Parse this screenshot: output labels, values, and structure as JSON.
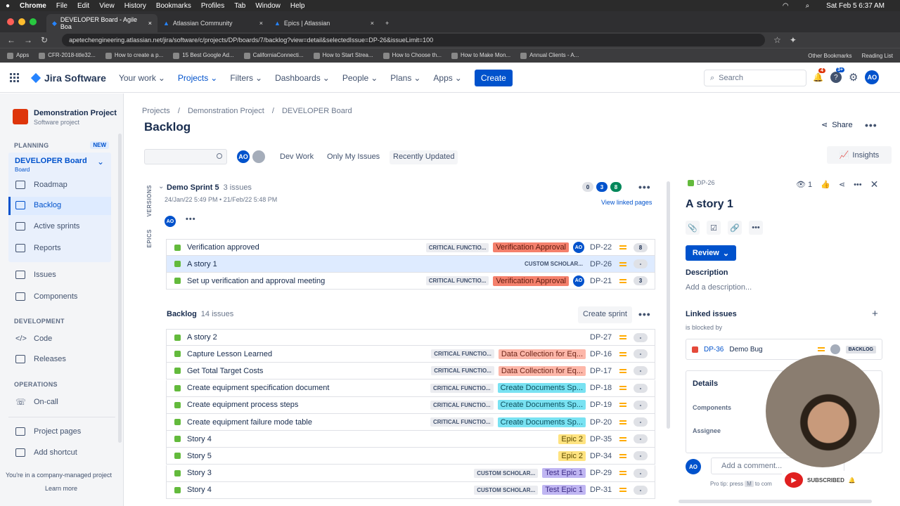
{
  "mac": {
    "app": "Chrome",
    "menus": [
      "File",
      "Edit",
      "View",
      "History",
      "Bookmarks",
      "Profiles",
      "Tab",
      "Window",
      "Help"
    ],
    "datetime": "Sat Feb 5  6:37 AM"
  },
  "browser": {
    "tabs": [
      {
        "label": "DEVELOPER Board - Agile Boa"
      },
      {
        "label": "Atlassian Community"
      },
      {
        "label": "Epics | Atlassian"
      }
    ],
    "url": "apetechengineering.atlassian.net/jira/software/c/projects/DP/boards/7/backlog?view=detail&selectedIssue=DP-26&issueLimit=100",
    "bookmarks": [
      "Apps",
      "CFR-2018-title32...",
      "How to create a p...",
      "15 Best Google Ad...",
      "CaliforniaConnecti...",
      "How to Start Strea...",
      "How to Choose th...",
      "How to Make Mon...",
      "Annual Clients - A..."
    ],
    "bookmarks_right": [
      "Other Bookmarks",
      "Reading List"
    ]
  },
  "jira_nav": {
    "logo": "Jira Software",
    "items": [
      "Your work",
      "Projects",
      "Filters",
      "Dashboards",
      "People",
      "Plans",
      "Apps"
    ],
    "create": "Create",
    "search_placeholder": "Search",
    "notif_badge": "4",
    "help_badge": "3+",
    "avatar": "AO"
  },
  "sidebar": {
    "project_name": "Demonstration Project",
    "project_type": "Software project",
    "planning_label": "PLANNING",
    "new_badge": "NEW",
    "board_title": "DEVELOPER Board",
    "board_sub": "Board",
    "planning_items": [
      "Roadmap",
      "Backlog",
      "Active sprints",
      "Reports"
    ],
    "other_items": [
      "Issues",
      "Components"
    ],
    "dev_label": "DEVELOPMENT",
    "dev_items": [
      "Code",
      "Releases"
    ],
    "ops_label": "OPERATIONS",
    "ops_items": [
      "On-call"
    ],
    "foot_items": [
      "Project pages",
      "Add shortcut"
    ],
    "footer_text": "You're in a company-managed project",
    "learn_more": "Learn more"
  },
  "main": {
    "breadcrumb": [
      "Projects",
      "/",
      "Demonstration Project",
      "/",
      "DEVELOPER Board"
    ],
    "title": "Backlog",
    "share": "Share",
    "insights": "Insights",
    "filters": [
      "Dev Work",
      "Only My Issues",
      "Recently Updated"
    ],
    "filter_avatar": "AO",
    "versions_tab": "VERSIONS",
    "epics_tab": "EPICS",
    "sprint": {
      "name": "Demo Sprint 5",
      "count": "3 issues",
      "dates": "24/Jan/22 5:49 PM  •  21/Feb/22 5:48 PM",
      "counts": [
        "0",
        "3",
        "8"
      ],
      "view_linked": "View linked pages",
      "avatar": "AO",
      "issues": [
        {
          "summary": "Verification approved",
          "label": "CRITICAL FUNCTIO...",
          "epic": "Verification Approval",
          "epic_color": "red",
          "assignee": "AO",
          "key": "DP-22",
          "est": "8"
        },
        {
          "summary": "A story 1",
          "label": "CUSTOM SCHOLAR...",
          "epic": "",
          "epic_color": "",
          "assignee": "",
          "key": "DP-26",
          "est": "-"
        },
        {
          "summary": "Set up verification and approval meeting",
          "label": "CRITICAL FUNCTIO...",
          "epic": "Verification Approval",
          "epic_color": "red",
          "assignee": "AO",
          "key": "DP-21",
          "est": "3"
        }
      ]
    },
    "backlog": {
      "name": "Backlog",
      "count": "14 issues",
      "create_sprint": "Create sprint",
      "issues": [
        {
          "summary": "A story 2",
          "label": "",
          "epic": "",
          "epic_color": "",
          "key": "DP-27",
          "est": "-"
        },
        {
          "summary": "Capture Lesson Learned",
          "label": "CRITICAL FUNCTIO...",
          "epic": "Data Collection for Eq...",
          "epic_color": "salmon",
          "key": "DP-16",
          "est": "-"
        },
        {
          "summary": "Get Total Target Costs",
          "label": "CRITICAL FUNCTIO...",
          "epic": "Data Collection for Eq...",
          "epic_color": "salmon",
          "key": "DP-17",
          "est": "-"
        },
        {
          "summary": "Create equipment specification document",
          "label": "CRITICAL FUNCTIO...",
          "epic": "Create Documents Sp...",
          "epic_color": "teal",
          "key": "DP-18",
          "est": "-"
        },
        {
          "summary": "Create equipment process steps",
          "label": "CRITICAL FUNCTIO...",
          "epic": "Create Documents Sp...",
          "epic_color": "teal",
          "key": "DP-19",
          "est": "-"
        },
        {
          "summary": "Create equipment failure mode table",
          "label": "CRITICAL FUNCTIO...",
          "epic": "Create Documents Sp...",
          "epic_color": "teal",
          "key": "DP-20",
          "est": "-"
        },
        {
          "summary": "Story 4",
          "label": "",
          "epic": "Epic 2",
          "epic_color": "yellow",
          "key": "DP-35",
          "est": "-"
        },
        {
          "summary": "Story 5",
          "label": "",
          "epic": "Epic 2",
          "epic_color": "yellow",
          "key": "DP-34",
          "est": "-"
        },
        {
          "summary": "Story 3",
          "label": "CUSTOM SCHOLAR...",
          "epic": "Test Epic 1",
          "epic_color": "purple",
          "key": "DP-29",
          "est": "-"
        },
        {
          "summary": "Story 4",
          "label": "CUSTOM SCHOLAR...",
          "epic": "Test Epic 1",
          "epic_color": "purple",
          "key": "DP-31",
          "est": "-"
        }
      ]
    }
  },
  "panel": {
    "key": "DP-26",
    "watch_count": "1",
    "title": "A story 1",
    "status": "Review",
    "description_label": "Description",
    "description_placeholder": "Add a description...",
    "linked_label": "Linked issues",
    "blocked_by": "is blocked by",
    "linked_key": "DP-36",
    "linked_summary": "Demo Bug",
    "linked_status": "BACKLOG",
    "details_label": "Details",
    "components_label": "Components",
    "assignee_label": "Assignee",
    "comment_avatar": "AO",
    "comment_placeholder": "Add a comment...",
    "protip_a": "Pro tip: press",
    "protip_key": "M",
    "protip_b": "to com",
    "subscribed": "SUBSCRIBED"
  },
  "colors": {
    "accent": "#0052CC",
    "story": "#63BA3C",
    "bug": "#E5493A"
  }
}
